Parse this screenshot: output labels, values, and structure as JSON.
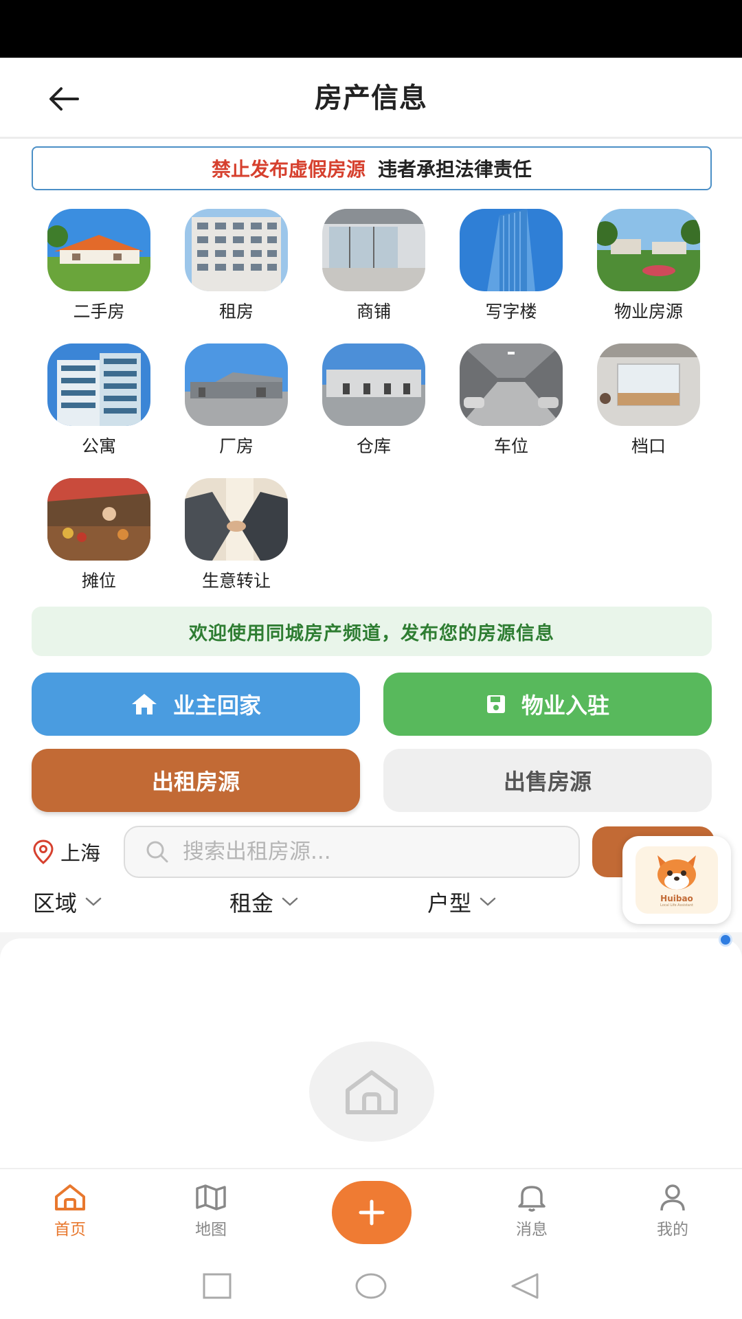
{
  "header": {
    "title": "房产信息"
  },
  "warning": {
    "red_text": "禁止发布虚假房源",
    "black_text": "违者承担法律责任"
  },
  "categories": [
    {
      "label": "二手房",
      "icon": "house-photo"
    },
    {
      "label": "租房",
      "icon": "apartment-building-photo"
    },
    {
      "label": "商铺",
      "icon": "storefront-photo"
    },
    {
      "label": "写字楼",
      "icon": "office-tower-photo"
    },
    {
      "label": "物业房源",
      "icon": "estate-garden-photo"
    },
    {
      "label": "公寓",
      "icon": "apartment-tower-photo"
    },
    {
      "label": "厂房",
      "icon": "factory-photo"
    },
    {
      "label": "仓库",
      "icon": "warehouse-photo"
    },
    {
      "label": "车位",
      "icon": "parking-garage-photo"
    },
    {
      "label": "档口",
      "icon": "market-stall-photo"
    },
    {
      "label": "摊位",
      "icon": "vendor-booth-photo"
    },
    {
      "label": "生意转让",
      "icon": "handshake-photo"
    }
  ],
  "welcome": {
    "text": "欢迎使用同城房产频道，发布您的房源信息"
  },
  "buttons": {
    "owner_home": "业主回家",
    "property_join": "物业入驻",
    "rent_listing": "出租房源",
    "sale_listing": "出售房源"
  },
  "search": {
    "city": "上海",
    "placeholder": "搜索出租房源..."
  },
  "filters": [
    {
      "label": "区域"
    },
    {
      "label": "租金"
    },
    {
      "label": "户型"
    }
  ],
  "mascot": {
    "name": "Huibao",
    "tagline": "Local Life Assistant"
  },
  "tabbar": {
    "home": "首页",
    "map": "地图",
    "messages": "消息",
    "mine": "我的"
  },
  "colors": {
    "accent": "#e8782e",
    "rent_brown": "#c26a35",
    "owner_blue": "#4a9ce0",
    "property_green": "#58b95c",
    "warning_red": "#d6402e"
  }
}
